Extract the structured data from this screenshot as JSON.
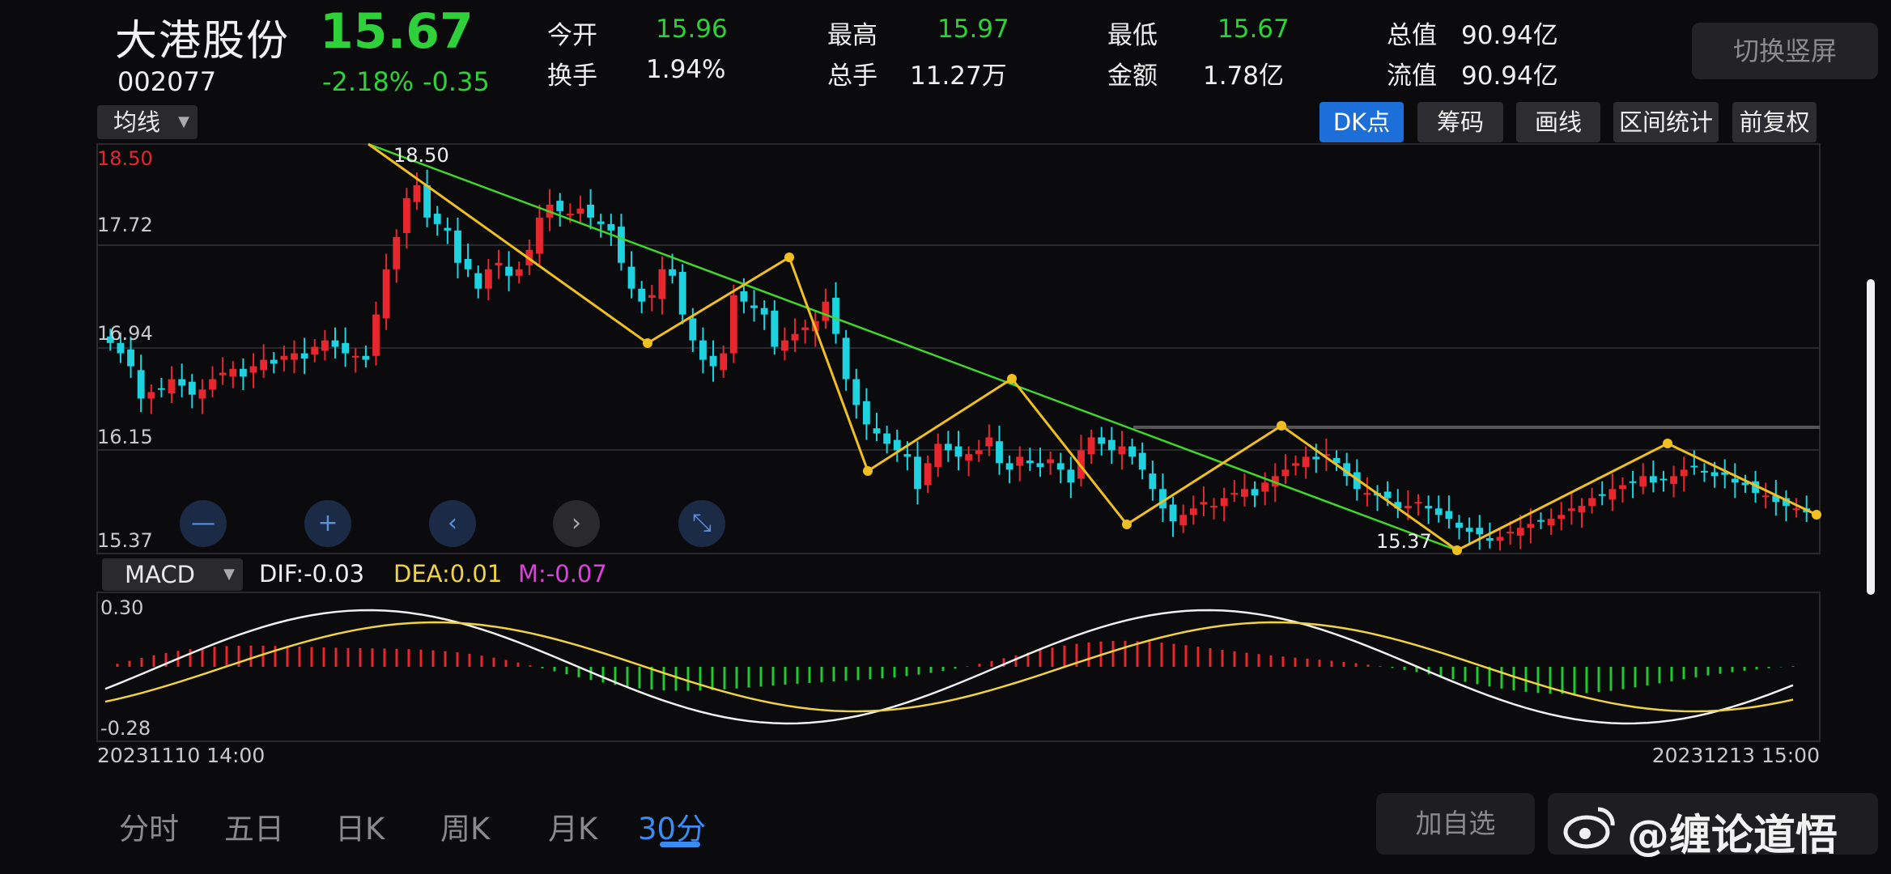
{
  "stock": {
    "name": "大港股份",
    "price": "15.67",
    "code": "002077",
    "change_pct": "-2.18%",
    "change_amt": "-0.35"
  },
  "quote": {
    "open_label": "今开",
    "open": "15.96",
    "high_label": "最高",
    "high": "15.97",
    "low_label": "最低",
    "low": "15.67",
    "mcap_label": "总值",
    "mcap": "90.94亿",
    "turnover_label": "换手",
    "turnover": "1.94%",
    "volume_label": "总手",
    "volume": "11.27万",
    "amount_label": "金额",
    "amount": "1.78亿",
    "float_label": "流值",
    "float_mcap": "90.94亿"
  },
  "switch_label": "切换竖屏",
  "toolbar": {
    "ma_select": "均线",
    "buttons": [
      "DK点",
      "筹码",
      "画线",
      "区间统计",
      "前复权"
    ]
  },
  "main_chart": {
    "top_left_label": "18.50",
    "y_ticks": [
      "17.72",
      "16.94",
      "16.15",
      "15.37"
    ],
    "high_label": "18.50",
    "low_label": "15.37",
    "date_start": "20231110 14:00",
    "date_end": "20231213 15:00"
  },
  "macd": {
    "select": "MACD",
    "dif": "DIF:-0.03",
    "dea": "DEA:0.01",
    "m": "M:-0.07",
    "y_top": "0.30",
    "y_bottom": "-0.28"
  },
  "tabs": [
    "分时",
    "五日",
    "日K",
    "周K",
    "月K",
    "30分"
  ],
  "active_tab": "30分",
  "add_watch": "加自选",
  "watermark": "@缠论道悟",
  "colors": {
    "up": "#e8262d",
    "down": "#1fd2e0",
    "price_green": "#2fd13b",
    "trend_green": "#41d62b",
    "stroke_yellow": "#f0c020",
    "accent": "#1c6fd8"
  },
  "chart_data": {
    "type": "candlestick",
    "title": "",
    "ylim": [
      15.37,
      18.5
    ],
    "x_range": [
      "20231110 14:00",
      "20231213 15:00"
    ],
    "closes": [
      16.98,
      16.9,
      16.8,
      16.55,
      16.6,
      16.62,
      16.7,
      16.65,
      16.58,
      16.62,
      16.7,
      16.75,
      16.78,
      16.72,
      16.8,
      16.85,
      16.82,
      16.88,
      16.9,
      16.86,
      16.95,
      17.0,
      16.95,
      16.9,
      16.88,
      16.85,
      17.2,
      17.55,
      17.8,
      18.1,
      18.2,
      17.95,
      17.9,
      17.85,
      17.6,
      17.55,
      17.4,
      17.55,
      17.6,
      17.5,
      17.55,
      17.7,
      17.95,
      18.05,
      18.0,
      17.98,
      18.02,
      17.95,
      17.9,
      17.85,
      17.6,
      17.4,
      17.3,
      17.35,
      17.55,
      17.5,
      17.2,
      17.0,
      16.85,
      16.8,
      16.9,
      17.35,
      17.3,
      17.25,
      17.2,
      16.95,
      17.0,
      17.05,
      17.1,
      17.15,
      17.3,
      17.05,
      16.7,
      16.5,
      16.35,
      16.28,
      16.2,
      16.15,
      16.1,
      15.85,
      16.05,
      16.2,
      16.15,
      16.1,
      16.12,
      16.15,
      16.25,
      16.05,
      16.0,
      16.1,
      16.05,
      16.02,
      16.08,
      16.0,
      15.9,
      16.15,
      16.25,
      16.2,
      16.15,
      16.18,
      16.1,
      16.0,
      15.85,
      15.7,
      15.6,
      15.65,
      15.7,
      15.75,
      15.72,
      15.78,
      15.82,
      15.85,
      15.8,
      15.9,
      15.95,
      16.0,
      16.05,
      16.1,
      16.08,
      16.12,
      16.05,
      15.95,
      15.85,
      15.82,
      15.8,
      15.78,
      15.7,
      15.72,
      15.75,
      15.7,
      15.65,
      15.62,
      15.55,
      15.52,
      15.5,
      15.45,
      15.48,
      15.52,
      15.55,
      15.58,
      15.6,
      15.62,
      15.65,
      15.7,
      15.72,
      15.78,
      15.8,
      15.85,
      15.88,
      15.9,
      15.95,
      15.9,
      15.92,
      15.95,
      16.0,
      16.02,
      15.98,
      15.95,
      15.96,
      15.9,
      15.88,
      15.82,
      15.8,
      15.75,
      15.72,
      15.7,
      15.67
    ],
    "high": 18.5,
    "low": 15.37,
    "macd": {
      "ylim": [
        -0.28,
        0.3
      ],
      "dif_last": -0.03,
      "dea_last": 0.01,
      "m_last": -0.07
    }
  }
}
